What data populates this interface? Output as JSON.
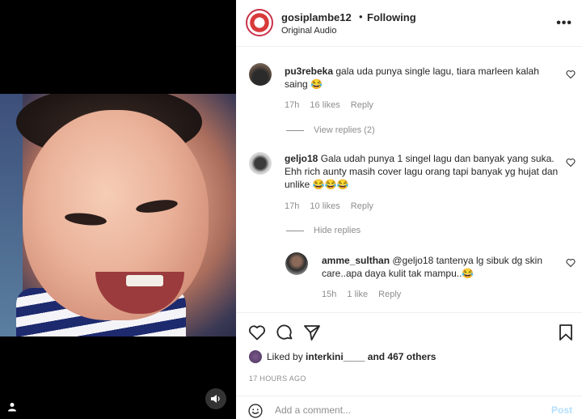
{
  "header": {
    "username": "gosiplambe12",
    "separator": "•",
    "follow_label": "Following",
    "audio_label": "Original Audio",
    "more_label": "•••"
  },
  "comments": [
    {
      "username": "pu3rebeka",
      "text": "gala uda punya single lagu, tiara marleen kalah saing 😂",
      "time": "17h",
      "likes": "16 likes",
      "reply_label": "Reply",
      "replies_toggle": "View replies (2)"
    },
    {
      "username": "geljo18",
      "text": "Gala udah punya 1 singel lagu dan banyak yang suka. Ehh rich aunty masih cover lagu orang tapi banyak yg hujat dan unlike 😂😂😂",
      "time": "17h",
      "likes": "10 likes",
      "reply_label": "Reply",
      "replies_toggle": "Hide replies",
      "replies": [
        {
          "username": "amme_sulthan",
          "text": "@geljo18 tantenya lg sibuk dg skin care..apa daya kulit tak mampu..😂",
          "time": "15h",
          "likes": "1 like",
          "reply_label": "Reply"
        }
      ]
    }
  ],
  "likes": {
    "prefix": "Liked by",
    "user": "interkini____",
    "suffix": "and 467 others"
  },
  "timestamp": "17 HOURS AGO",
  "composer": {
    "placeholder": "Add a comment...",
    "post_label": "Post"
  },
  "colors": {
    "accent_disabled": "#b2dffc",
    "secondary_text": "#8e8e8e",
    "avatar_ring": "#c9324a"
  }
}
